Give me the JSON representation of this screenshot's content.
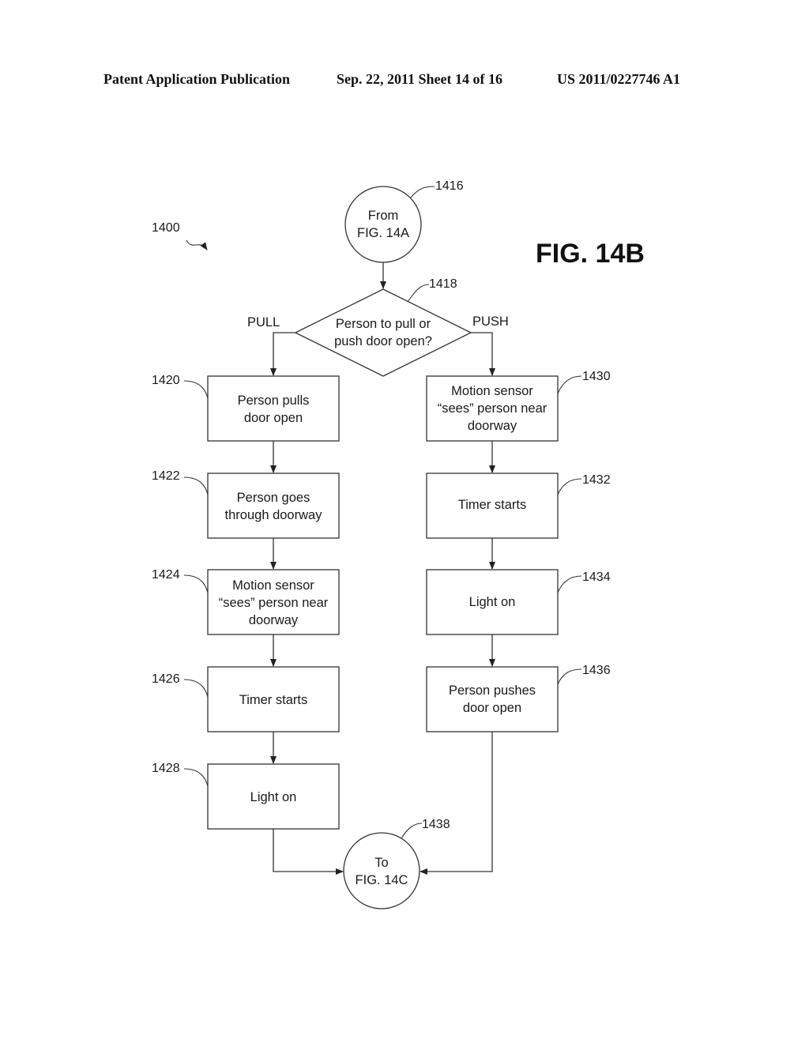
{
  "header": {
    "publication": "Patent Application Publication",
    "date_sheet": "Sep. 22, 2011   Sheet 14 of 16",
    "patent_number": "US 2011/0227746 A1"
  },
  "figure": {
    "label": "FIG. 14B",
    "ref": "1400"
  },
  "nodes": {
    "start": {
      "ref": "1416",
      "lines": [
        "From",
        "FIG. 14A"
      ]
    },
    "decision": {
      "ref": "1418",
      "lines": [
        "Person to pull or",
        "push door open?"
      ],
      "left_branch": "PULL",
      "right_branch": "PUSH"
    },
    "n1420": {
      "ref": "1420",
      "lines": [
        "Person pulls",
        "door open"
      ]
    },
    "n1422": {
      "ref": "1422",
      "lines": [
        "Person goes",
        "through doorway"
      ]
    },
    "n1424": {
      "ref": "1424",
      "lines": [
        "Motion sensor",
        "“sees” person near",
        "doorway"
      ]
    },
    "n1426": {
      "ref": "1426",
      "lines": [
        "Timer starts"
      ]
    },
    "n1428": {
      "ref": "1428",
      "lines": [
        "Light on"
      ]
    },
    "n1430": {
      "ref": "1430",
      "lines": [
        "Motion sensor",
        "“sees” person near",
        "doorway"
      ]
    },
    "n1432": {
      "ref": "1432",
      "lines": [
        "Timer starts"
      ]
    },
    "n1434": {
      "ref": "1434",
      "lines": [
        "Light on"
      ]
    },
    "n1436": {
      "ref": "1436",
      "lines": [
        "Person pushes",
        "door open"
      ]
    },
    "end": {
      "ref": "1438",
      "lines": [
        "To",
        "FIG. 14C"
      ]
    }
  }
}
